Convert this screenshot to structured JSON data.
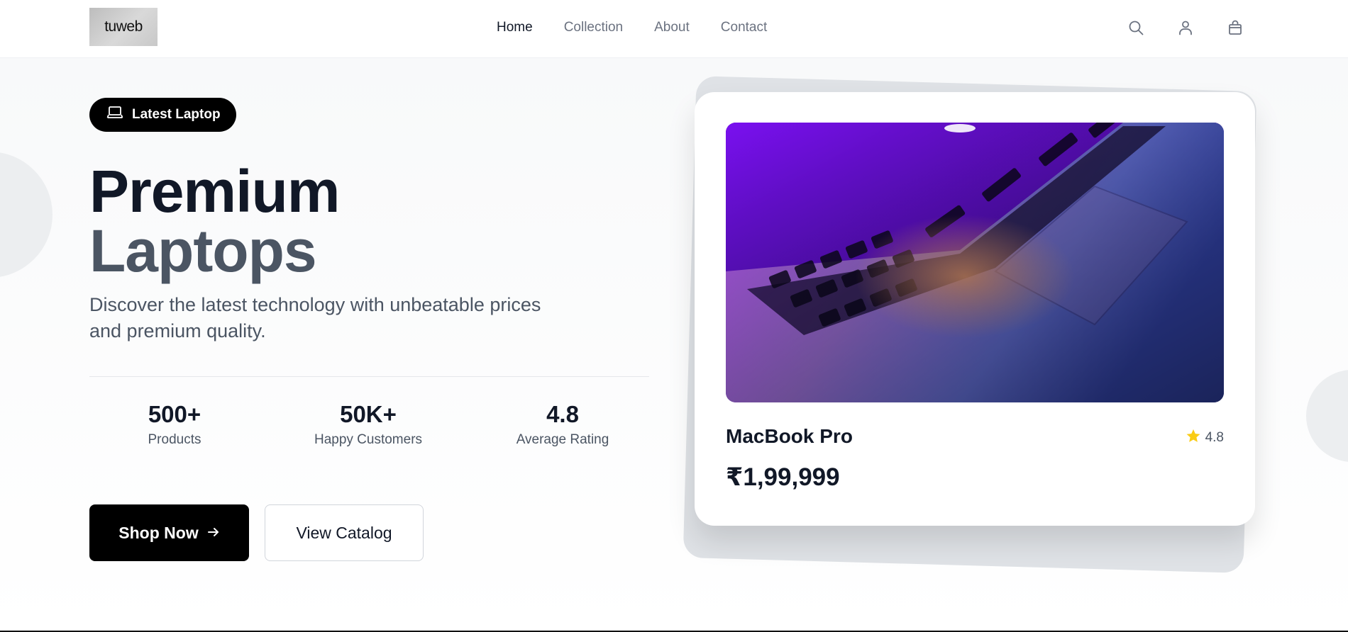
{
  "brand": {
    "logo_text": "tuweb"
  },
  "nav": {
    "items": [
      {
        "label": "Home",
        "active": true
      },
      {
        "label": "Collection",
        "active": false
      },
      {
        "label": "About",
        "active": false
      },
      {
        "label": "Contact",
        "active": false
      }
    ]
  },
  "header_icons": [
    "search-icon",
    "user-icon",
    "shopping-bag-icon"
  ],
  "hero": {
    "badge": {
      "icon": "laptop-icon",
      "label": "Latest Laptop"
    },
    "title_line1": "Premium",
    "title_line2": "Laptops",
    "subtitle": "Discover the latest technology with unbeatable prices and premium quality.",
    "stats": [
      {
        "value": "500+",
        "label": "Products"
      },
      {
        "value": "50K+",
        "label": "Happy Customers"
      },
      {
        "value": "4.8",
        "label": "Average Rating"
      }
    ],
    "primary_button": "Shop Now",
    "secondary_button": "View Catalog"
  },
  "product_card": {
    "name": "MacBook Pro",
    "rating": "4.8",
    "price": "₹1,99,999"
  },
  "colors": {
    "primary": "#000000",
    "heading_dark": "#111827",
    "heading_muted": "#4b5563",
    "text_muted": "#6b7280",
    "star": "#facc15"
  }
}
